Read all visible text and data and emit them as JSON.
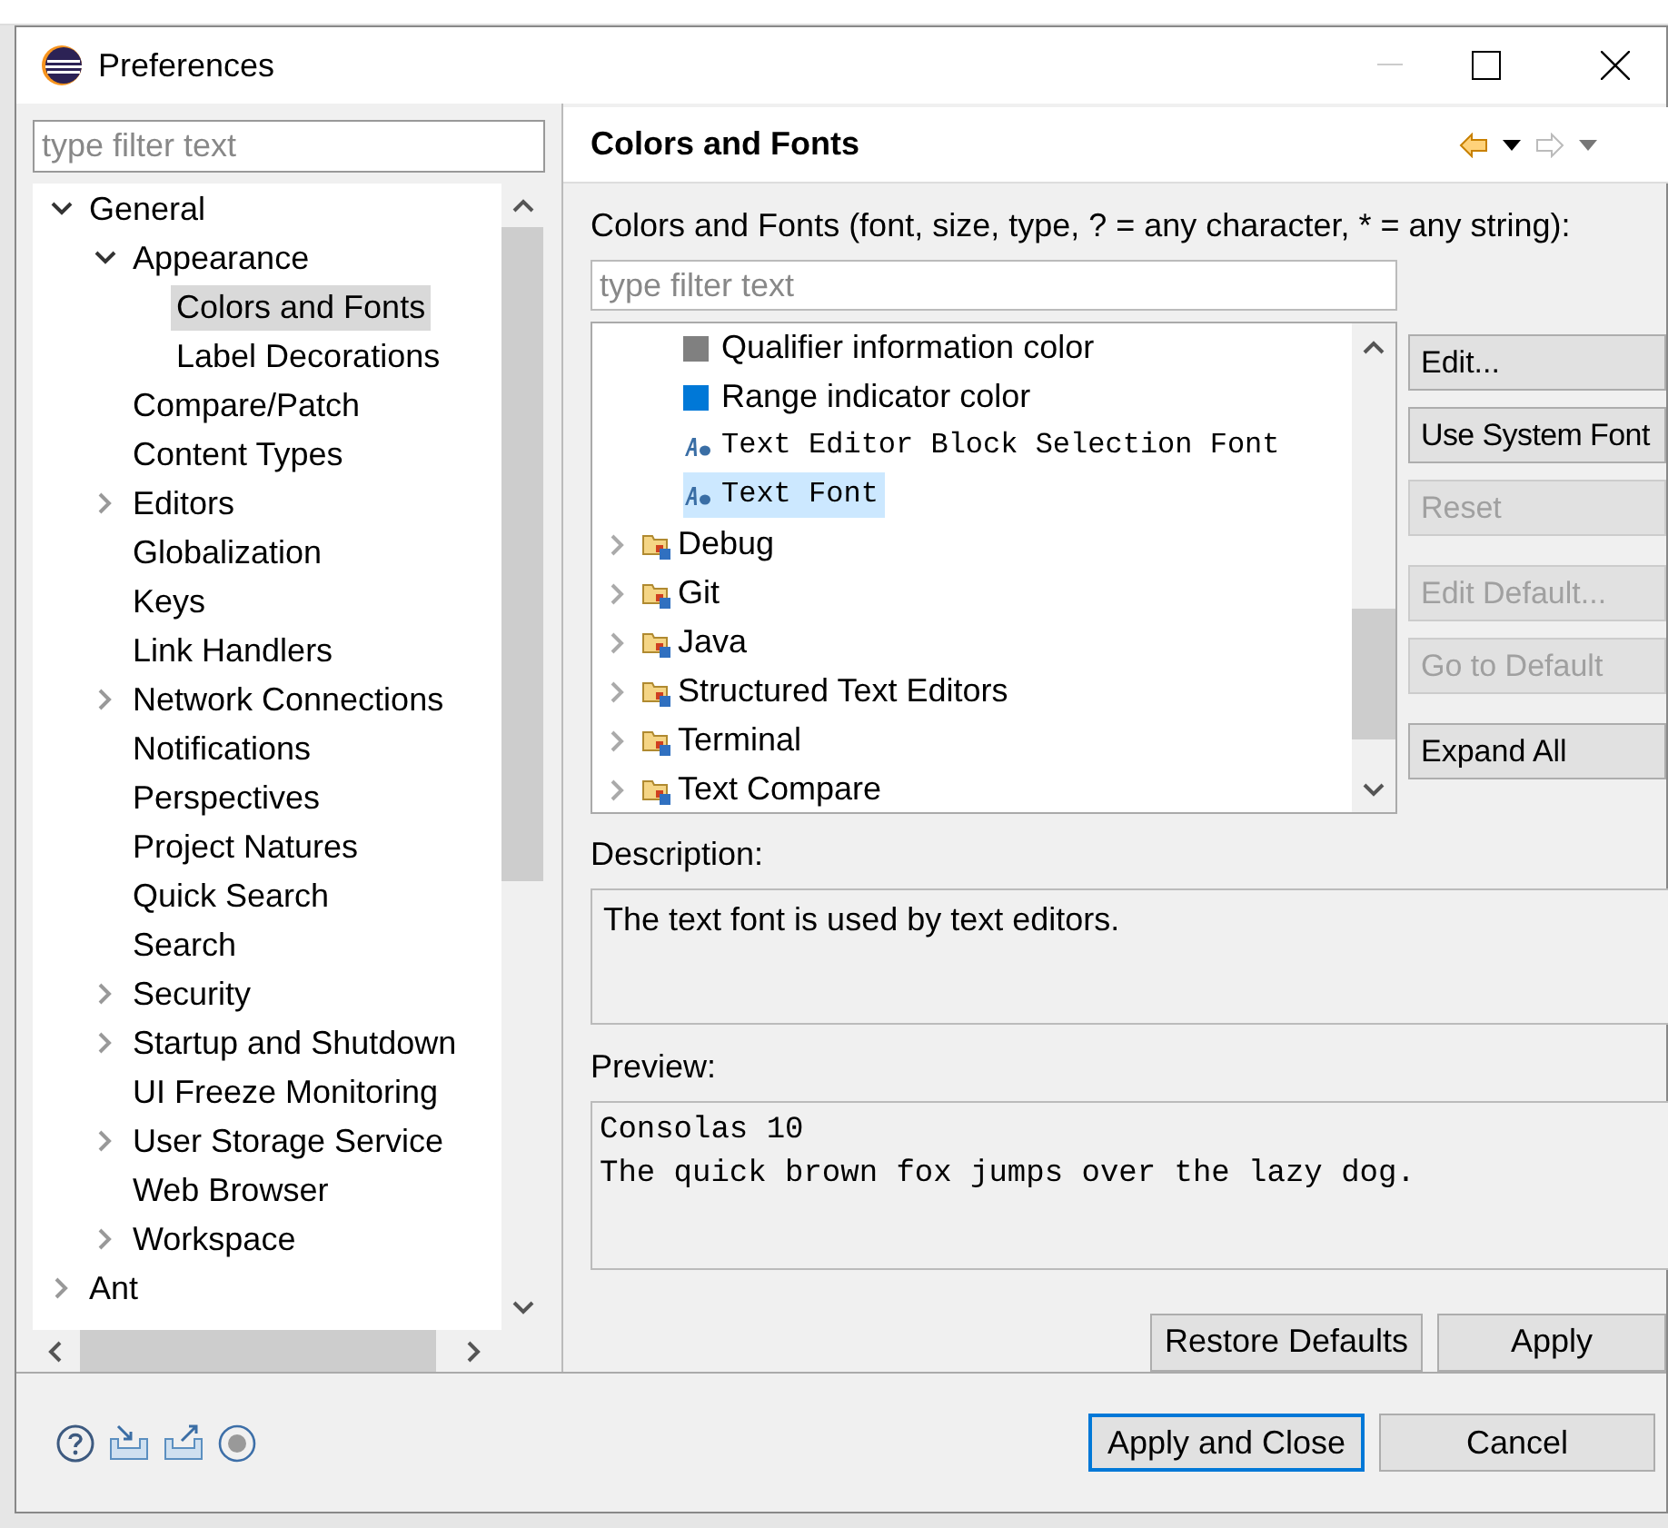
{
  "window": {
    "title": "Preferences"
  },
  "nav": {
    "filter_placeholder": "type filter text",
    "tree": [
      {
        "label": "General",
        "expanded": true,
        "selected": false,
        "children": [
          {
            "label": "Appearance",
            "expanded": true,
            "selected": false,
            "children": [
              {
                "label": "Colors and Fonts",
                "selected": true
              },
              {
                "label": "Label Decorations",
                "selected": false
              }
            ]
          },
          {
            "label": "Compare/Patch",
            "selected": false
          },
          {
            "label": "Content Types",
            "selected": false
          },
          {
            "label": "Editors",
            "expanded": false,
            "selected": false
          },
          {
            "label": "Globalization",
            "selected": false
          },
          {
            "label": "Keys",
            "selected": false
          },
          {
            "label": "Link Handlers",
            "selected": false
          },
          {
            "label": "Network Connections",
            "expanded": false,
            "selected": false
          },
          {
            "label": "Notifications",
            "selected": false
          },
          {
            "label": "Perspectives",
            "selected": false
          },
          {
            "label": "Project Natures",
            "selected": false
          },
          {
            "label": "Quick Search",
            "selected": false
          },
          {
            "label": "Search",
            "selected": false
          },
          {
            "label": "Security",
            "expanded": false,
            "selected": false
          },
          {
            "label": "Startup and Shutdown",
            "expanded": false,
            "selected": false
          },
          {
            "label": "UI Freeze Monitoring",
            "selected": false
          },
          {
            "label": "User Storage Service",
            "expanded": false,
            "selected": false
          },
          {
            "label": "Web Browser",
            "selected": false
          },
          {
            "label": "Workspace",
            "expanded": false,
            "selected": false
          }
        ]
      },
      {
        "label": "Ant",
        "expanded": false,
        "selected": false
      }
    ]
  },
  "page": {
    "title": "Colors and Fonts",
    "list_label": "Colors and Fonts (font, size, type, ? = any character, * = any string):",
    "filter_placeholder": "type filter text",
    "items": [
      {
        "label": "Qualifier information color",
        "kind": "color",
        "color": "#808080",
        "selected": false
      },
      {
        "label": "Range indicator color",
        "kind": "color",
        "color": "#0078d7",
        "selected": false
      },
      {
        "label": "Text Editor Block Selection Font",
        "kind": "font",
        "selected": false
      },
      {
        "label": "Text Font",
        "kind": "font",
        "selected": true
      },
      {
        "label": "Debug",
        "kind": "category",
        "expanded": false,
        "selected": false
      },
      {
        "label": "Git",
        "kind": "category",
        "expanded": false,
        "selected": false
      },
      {
        "label": "Java",
        "kind": "category",
        "expanded": false,
        "selected": false
      },
      {
        "label": "Structured Text Editors",
        "kind": "category",
        "expanded": false,
        "selected": false
      },
      {
        "label": "Terminal",
        "kind": "category",
        "expanded": false,
        "selected": false
      },
      {
        "label": "Text Compare",
        "kind": "category",
        "expanded": false,
        "selected": false
      }
    ],
    "side_buttons": [
      {
        "label": "Edit...",
        "disabled": false
      },
      {
        "label": "Use System Font",
        "disabled": false
      },
      {
        "label": "Reset",
        "disabled": true
      },
      {
        "label": "Edit Default...",
        "disabled": true
      },
      {
        "label": "Go to Default",
        "disabled": true
      },
      {
        "label": "Expand All",
        "disabled": false
      }
    ],
    "description_label": "Description:",
    "description": "The text font is used by text editors.",
    "preview_label": "Preview:",
    "preview_lines": [
      "Consolas 10",
      "The quick brown fox jumps over the lazy dog."
    ],
    "page_buttons": [
      "Restore Defaults",
      "Apply"
    ]
  },
  "dialog_buttons": [
    {
      "label": "Apply and Close",
      "default": true
    },
    {
      "label": "Cancel",
      "default": false
    }
  ]
}
